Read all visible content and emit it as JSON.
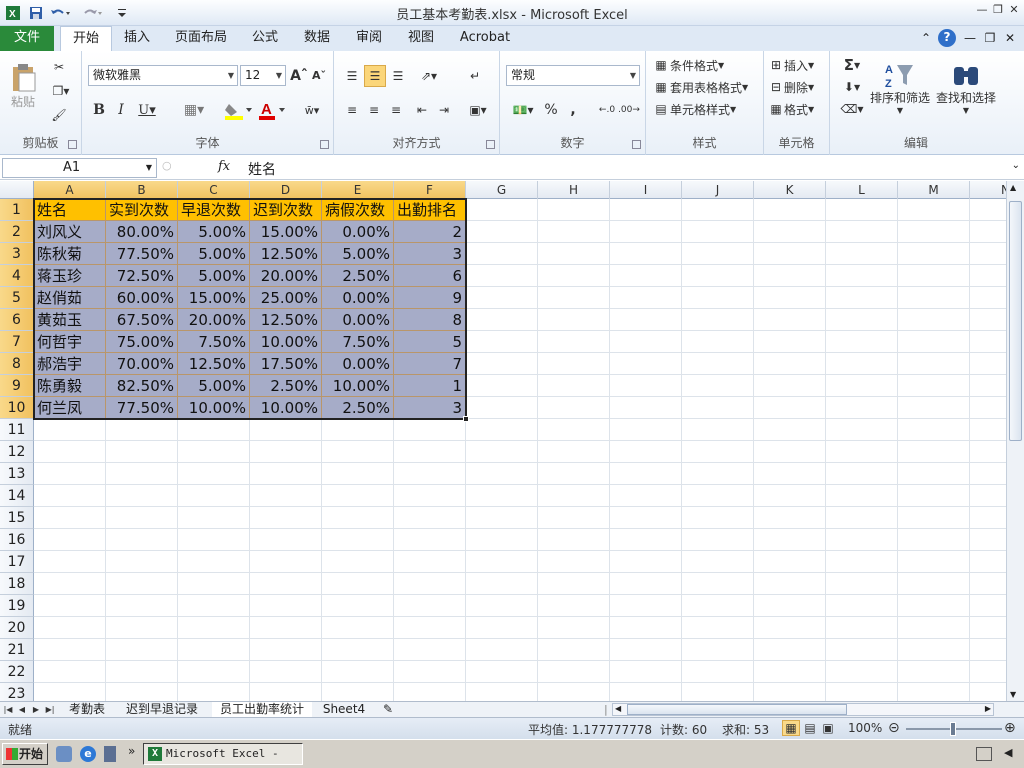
{
  "titlebar": {
    "title": "员工基本考勤表.xlsx - Microsoft Excel"
  },
  "ribbon_tabs": [
    "文件",
    "开始",
    "插入",
    "页面布局",
    "公式",
    "数据",
    "审阅",
    "视图",
    "Acrobat"
  ],
  "ribbon": {
    "clipboard": {
      "label": "剪贴板",
      "paste": "粘贴"
    },
    "font": {
      "label": "字体",
      "font_name": "微软雅黑",
      "font_size": "12"
    },
    "alignment": {
      "label": "对齐方式"
    },
    "number": {
      "label": "数字",
      "format": "常规"
    },
    "styles": {
      "label": "样式",
      "cond_format": "条件格式",
      "table_format": "套用表格格式",
      "cell_styles": "单元格样式"
    },
    "cells": {
      "label": "单元格",
      "insert": "插入",
      "delete": "删除",
      "format": "格式"
    },
    "editing": {
      "label": "编辑",
      "sort_filter": "排序和筛选",
      "find_select": "查找和选择"
    }
  },
  "formula_bar": {
    "name_box": "A1",
    "fx": "fx",
    "value": "姓名"
  },
  "columns": [
    "A",
    "B",
    "C",
    "D",
    "E",
    "F",
    "G",
    "H",
    "I",
    "J",
    "K",
    "L",
    "M",
    "N"
  ],
  "rows": [
    "1",
    "2",
    "3",
    "4",
    "5",
    "6",
    "7",
    "8",
    "9",
    "10",
    "11",
    "12",
    "13",
    "14",
    "15",
    "16",
    "17",
    "18",
    "19",
    "20",
    "21",
    "22",
    "23"
  ],
  "table": {
    "headers": [
      "姓名",
      "实到次数",
      "早退次数",
      "迟到次数",
      "病假次数",
      "出勤排名"
    ],
    "rows": [
      [
        "刘风义",
        "80.00%",
        "5.00%",
        "15.00%",
        "0.00%",
        "2"
      ],
      [
        "陈秋菊",
        "77.50%",
        "5.00%",
        "12.50%",
        "5.00%",
        "3"
      ],
      [
        "蒋玉珍",
        "72.50%",
        "5.00%",
        "20.00%",
        "2.50%",
        "6"
      ],
      [
        "赵俏茹",
        "60.00%",
        "15.00%",
        "25.00%",
        "0.00%",
        "9"
      ],
      [
        "黄茹玉",
        "67.50%",
        "20.00%",
        "12.50%",
        "0.00%",
        "8"
      ],
      [
        "何哲宇",
        "75.00%",
        "7.50%",
        "10.00%",
        "7.50%",
        "5"
      ],
      [
        "郝浩宇",
        "70.00%",
        "12.50%",
        "17.50%",
        "0.00%",
        "7"
      ],
      [
        "陈勇毅",
        "82.50%",
        "5.00%",
        "2.50%",
        "10.00%",
        "1"
      ],
      [
        "何兰凤",
        "77.50%",
        "10.00%",
        "10.00%",
        "2.50%",
        "3"
      ]
    ]
  },
  "sheets": [
    "考勤表",
    "迟到早退记录",
    "员工出勤率统计",
    "Sheet4"
  ],
  "active_sheet": 2,
  "status": {
    "ready": "就绪",
    "average": "平均值: 1.177777778",
    "count": "计数: 60",
    "sum": "求和: 53",
    "zoom": "100%"
  },
  "taskbar": {
    "start": "开始",
    "window": "Microsoft Excel - ..."
  },
  "colors": {
    "header_fill": "#ffc000",
    "body_fill": "#a6acc8",
    "file_tab": "#2a8a3a"
  }
}
